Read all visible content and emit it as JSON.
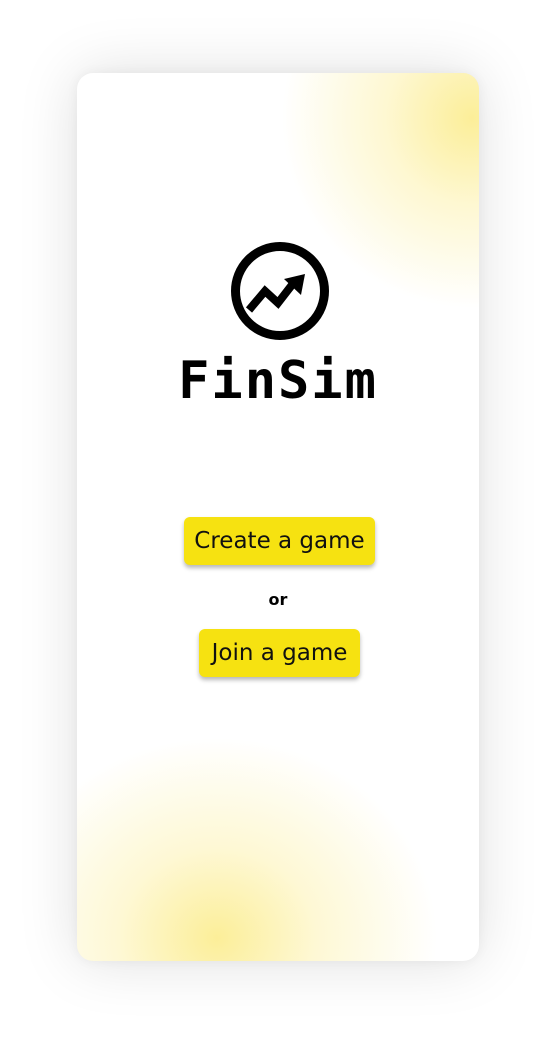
{
  "app": {
    "name": "FinSim",
    "logo_icon": "trending-up-circle-icon"
  },
  "actions": {
    "create_label": "Create a game",
    "separator": "or",
    "join_label": "Join a game"
  },
  "colors": {
    "button_bg": "#f6e211",
    "accent_glow": "#fae45a",
    "text": "#000000"
  }
}
